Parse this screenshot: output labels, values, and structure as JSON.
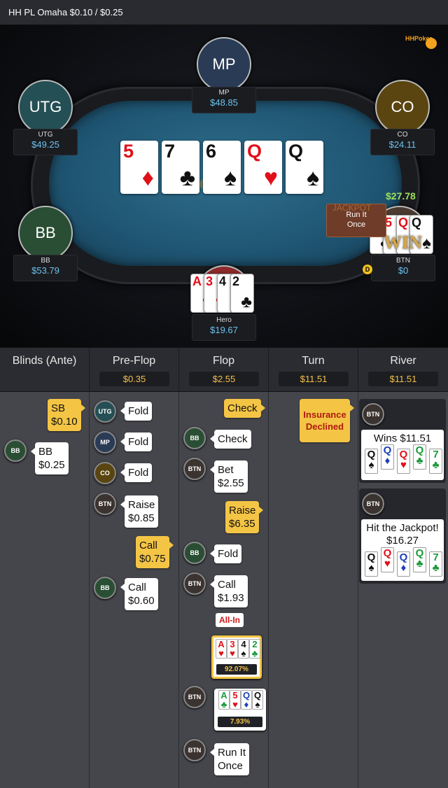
{
  "header": {
    "title": "HH PL Omaha $0.10 / $0.25"
  },
  "brand": {
    "logo_text": "HHPoker"
  },
  "seats": {
    "mp": {
      "avatar": "MP",
      "name": "MP",
      "stack": "$48.85",
      "color": "#2a3b56"
    },
    "utg": {
      "avatar": "UTG",
      "name": "UTG",
      "stack": "$49.25",
      "color": "#244f54"
    },
    "co": {
      "avatar": "CO",
      "name": "CO",
      "stack": "$24.11",
      "color": "#5a4510"
    },
    "bb": {
      "avatar": "BB",
      "name": "BB",
      "stack": "$53.79",
      "color": "#2a4e34"
    },
    "btn": {
      "name": "BTN",
      "stack": "$0"
    },
    "hero": {
      "name": "Hero",
      "stack": "$19.67"
    }
  },
  "board": [
    {
      "rank": "5",
      "suit": "♦",
      "color": "red"
    },
    {
      "rank": "7",
      "suit": "♣",
      "color": "blk"
    },
    {
      "rank": "6",
      "suit": "♠",
      "color": "blk"
    },
    {
      "rank": "Q",
      "suit": "♥",
      "color": "red"
    },
    {
      "rank": "Q",
      "suit": "♠",
      "color": "blk"
    }
  ],
  "hero_cards": [
    {
      "rank": "A",
      "suit": "♥",
      "color": "red"
    },
    {
      "rank": "3",
      "suit": "♥",
      "color": "red"
    },
    {
      "rank": "4",
      "suit": "♠",
      "color": "blk"
    },
    {
      "rank": "2",
      "suit": "♣",
      "color": "blk"
    }
  ],
  "btn_cards": [
    {
      "rank": "A",
      "suit": "♣",
      "color": "blk"
    },
    {
      "rank": "5",
      "suit": "♥",
      "color": "red"
    },
    {
      "rank": "Q",
      "suit": "♦",
      "color": "red"
    },
    {
      "rank": "Q",
      "suit": "♠",
      "color": "blk"
    }
  ],
  "table": {
    "win_amount": "$27.78",
    "win_text": "WIN",
    "run_it_once": "Run It Once",
    "jackpot_label": "JACKPOT",
    "dealer": "D",
    "felt_logo": "poker"
  },
  "streets": [
    {
      "name": "Blinds (Ante)",
      "pot": ""
    },
    {
      "name": "Pre-Flop",
      "pot": "$0.35"
    },
    {
      "name": "Flop",
      "pot": "$2.55"
    },
    {
      "name": "Turn",
      "pot": "$11.51"
    },
    {
      "name": "River",
      "pot": "$11.51"
    }
  ],
  "actions": {
    "blinds": {
      "sb": "SB\n$0.10",
      "bb_chip": "BB",
      "bb": "BB\n$0.25"
    },
    "preflop": {
      "utg_chip": "UTG",
      "utg": "Fold",
      "mp_chip": "MP",
      "mp": "Fold",
      "co_chip": "CO",
      "co": "Fold",
      "btn_chip": "BTN",
      "btn": "Raise\n$0.85",
      "hero": "Call\n$0.75",
      "bb_chip": "BB",
      "bb": "Call\n$0.60"
    },
    "flop": {
      "hero_check": "Check",
      "bb_chip": "BB",
      "bb_check": "Check",
      "btn_chip": "BTN",
      "btn_bet": "Bet\n$2.55",
      "hero_raise": "Raise\n$6.35",
      "bb_chip2": "BB",
      "bb_fold": "Fold",
      "btn_chip2": "BTN",
      "btn_call": "Call\n$1.93",
      "allin": "All-In",
      "hero_equity_cards": [
        {
          "rank": "A",
          "suit": "♥",
          "color": "red"
        },
        {
          "rank": "3",
          "suit": "♥",
          "color": "red"
        },
        {
          "rank": "4",
          "suit": "♠",
          "color": "blk"
        },
        {
          "rank": "2",
          "suit": "♣",
          "color": "grn"
        }
      ],
      "hero_equity": "92.07%",
      "btn_chip3": "BTN",
      "btn_equity_cards": [
        {
          "rank": "A",
          "suit": "♣",
          "color": "grn"
        },
        {
          "rank": "5",
          "suit": "♥",
          "color": "red"
        },
        {
          "rank": "Q",
          "suit": "♦",
          "color": "blu"
        },
        {
          "rank": "Q",
          "suit": "♠",
          "color": "blk"
        }
      ],
      "btn_equity": "7.93%",
      "btn_chip4": "BTN",
      "btn_run": "Run It\nOnce"
    },
    "turn": {
      "insurance": "Insurance\nDeclined"
    },
    "river": {
      "btn_chip": "BTN",
      "wins": "Wins $11.51",
      "wins_cards": [
        {
          "rank": "Q",
          "suit": "♠",
          "color": "blk"
        },
        {
          "rank": "Q",
          "suit": "♦",
          "color": "blu"
        },
        {
          "rank": "Q",
          "suit": "♥",
          "color": "red"
        },
        {
          "rank": "Q",
          "suit": "♣",
          "color": "grn"
        },
        {
          "rank": "7",
          "suit": "♣",
          "color": "grn"
        }
      ],
      "btn_chip2": "BTN",
      "jackpot": "Hit the Jackpot!\n$16.27",
      "jackpot_cards": [
        {
          "rank": "Q",
          "suit": "♠",
          "color": "blk"
        },
        {
          "rank": "Q",
          "suit": "♥",
          "color": "red"
        },
        {
          "rank": "Q",
          "suit": "♦",
          "color": "blu"
        },
        {
          "rank": "Q",
          "suit": "♣",
          "color": "grn"
        },
        {
          "rank": "7",
          "suit": "♣",
          "color": "grn"
        }
      ]
    }
  }
}
